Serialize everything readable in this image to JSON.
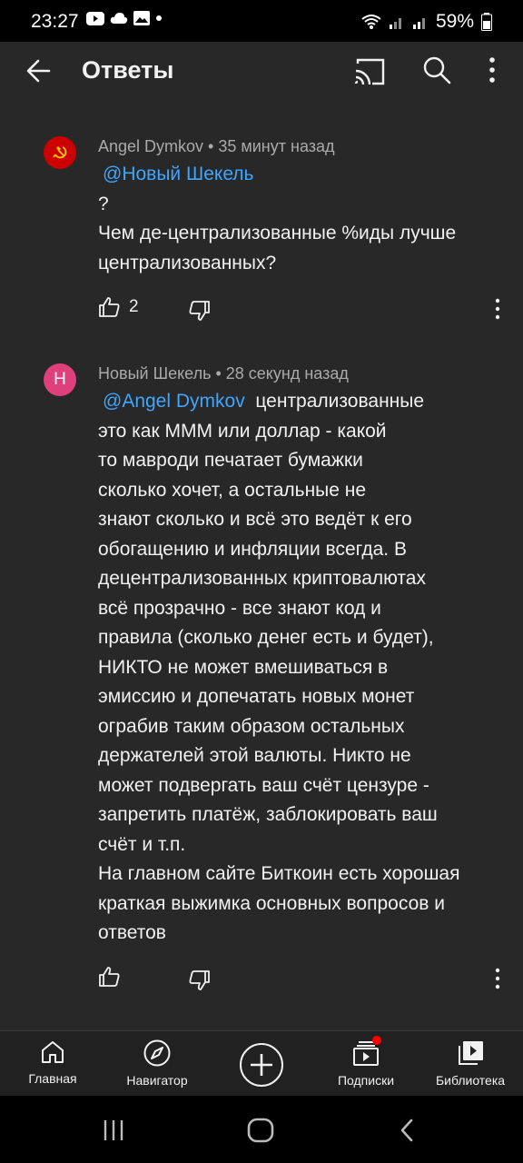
{
  "status_bar": {
    "time": "23:27",
    "battery": "59%",
    "notification_icons": [
      "youtube-icon",
      "cloud-icon",
      "gallery-icon",
      "dot-icon"
    ]
  },
  "app_bar": {
    "title": "Ответы",
    "icons": [
      "back-arrow-icon",
      "cast-icon",
      "search-icon",
      "more-vert-icon"
    ]
  },
  "comments": [
    {
      "author": "Angel Dymkov",
      "separator": " • ",
      "time": "35 минут назад",
      "mention": "@Новый Шекель",
      "text": "?\nЧем де-централизованные %иды лучше централизованных?",
      "likes": "2",
      "avatar_letter": "",
      "avatar_color": "#cc0000"
    },
    {
      "author": "Новый Шекель",
      "separator": " • ",
      "time": "28 секунд назад",
      "mention": "@Angel Dymkov",
      "text_after_mention": "  централизованные",
      "text": "это как МММ или доллар - какой\nто мавроди печатает бумажки\nсколько хочет, а остальные не\nзнают сколько и всё это ведёт к его\nобогащению и инфляции всегда. В\nдецентрализованных криптовалютах\nвсё прозрачно - все знают код и\nправила (сколько денег есть и будет),\nНИКТО не может вмешиваться в\nэмиссию и допечатать новых монет\nограбив таким образом остальных\nдержателей этой валюты. Никто не\nможет подвергать ваш счёт цензуре -\nзапретить платёж, заблокировать ваш\nсчёт и т.п.\nНа главном сайте Биткоин есть хорошая\nкраткая выжимка основных вопросов и\nответов",
      "likes": "",
      "avatar_letter": "Н",
      "avatar_color": "#e0407a"
    }
  ],
  "bottom_nav": {
    "items": [
      {
        "label": "Главная",
        "icon": "home-icon"
      },
      {
        "label": "Навигатор",
        "icon": "compass-icon"
      },
      {
        "label": "",
        "icon": "add-icon"
      },
      {
        "label": "Подписки",
        "icon": "subscriptions-icon"
      },
      {
        "label": "Библиотека",
        "icon": "library-icon"
      }
    ],
    "subscriptions_badge_color": "#ff0000"
  },
  "system_nav": {
    "icons": [
      "recents-icon",
      "home-pill-icon",
      "back-chevron-icon"
    ]
  }
}
